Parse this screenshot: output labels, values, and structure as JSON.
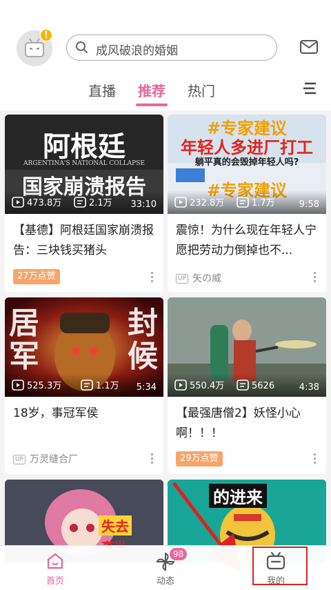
{
  "header": {
    "avatar_badge": "!",
    "search_placeholder": "成风破浪的婚姻",
    "tabs": [
      {
        "label": "直播"
      },
      {
        "label": "推荐"
      },
      {
        "label": "热门"
      }
    ],
    "active_tab": "推荐"
  },
  "cards": [
    {
      "thumb_text_top": "阿根廷",
      "thumb_text_sub": "ARGENTINA'S NATIONAL COLLAPSE",
      "thumb_text_bottom": "国家崩溃报告",
      "views": "473.8万",
      "danmaku": "2.1万",
      "duration": "33:10",
      "title": "【基德】阿根廷国家崩溃报告：三块钱买猪头",
      "like_badge": "27万点赞"
    },
    {
      "thumb_text_top": "#专家建议",
      "thumb_text_mid": "年轻人多进厂打工",
      "thumb_text_q": "躺平真的会毁掉年轻人吗?",
      "thumb_text_bottom": "#专家建议",
      "views": "232.8万",
      "danmaku": "1.7万",
      "duration": "9:58",
      "title": "震惊！为什么现在年轻人宁愿把劳动力倒掉也不...",
      "up_name": "矢の威"
    },
    {
      "thumb_text_left": "居军",
      "thumb_text_right": "封候",
      "views": "525.3万",
      "danmaku": "1.1万",
      "duration": "5:34",
      "title": "18岁，事冠军侯",
      "up_name": "万灵缝合厂"
    },
    {
      "views": "550.4万",
      "danmaku": "5626",
      "duration": "4:38",
      "title": "【最强唐僧2】妖怪小心啊！！！",
      "like_badge": "29万点赞"
    },
    {
      "thumb_text": "失去",
      "thumb_text2": "高光"
    },
    {
      "thumb_text": "的进来"
    }
  ],
  "up_tag": "UP",
  "bottom_nav": {
    "items": [
      {
        "label": "首页"
      },
      {
        "label": "动态",
        "badge": "98"
      },
      {
        "label": "我的"
      }
    ]
  },
  "colors": {
    "accent": "#e8669a",
    "like_badge": "#f8a46a",
    "highlight_box": "#e02020"
  }
}
